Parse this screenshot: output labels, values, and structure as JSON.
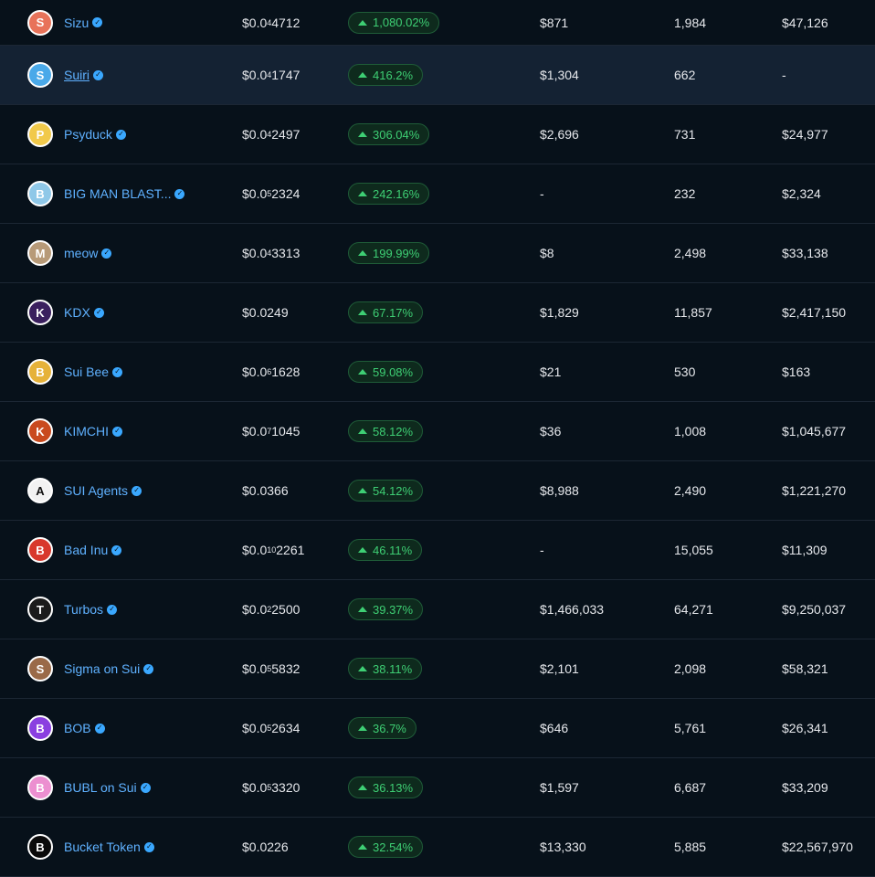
{
  "rows": [
    {
      "id": "sizu",
      "name": "Sizu",
      "avatar_color": "#e8735a",
      "avatar_glyph": "S",
      "price_prefix": "$0.0",
      "price_zeros": "4",
      "price_digits": "4712",
      "change": "1,080.02%",
      "liquidity": "$871",
      "holders": "1,984",
      "mcap": "$47,126"
    },
    {
      "id": "suiri",
      "name": "Suiri",
      "avatar_color": "#4aa9e9",
      "avatar_glyph": "S",
      "price_prefix": "$0.0",
      "price_zeros": "4",
      "price_digits": "1747",
      "change": "416.2%",
      "liquidity": "$1,304",
      "holders": "662",
      "mcap": "-"
    },
    {
      "id": "psyduck",
      "name": "Psyduck",
      "avatar_color": "#f1c94a",
      "avatar_glyph": "P",
      "price_prefix": "$0.0",
      "price_zeros": "4",
      "price_digits": "2497",
      "change": "306.04%",
      "liquidity": "$2,696",
      "holders": "731",
      "mcap": "$24,977"
    },
    {
      "id": "bigman",
      "name": "BIG MAN BLAST...",
      "avatar_color": "#8fc8e8",
      "avatar_glyph": "B",
      "price_prefix": "$0.0",
      "price_zeros": "5",
      "price_digits": "2324",
      "change": "242.16%",
      "liquidity": "-",
      "holders": "232",
      "mcap": "$2,324"
    },
    {
      "id": "meow",
      "name": "meow",
      "avatar_color": "#b79a78",
      "avatar_glyph": "M",
      "price_prefix": "$0.0",
      "price_zeros": "4",
      "price_digits": "3313",
      "change": "199.99%",
      "liquidity": "$8",
      "holders": "2,498",
      "mcap": "$33,138"
    },
    {
      "id": "kdx",
      "name": "KDX",
      "avatar_color": "#3a1f5e",
      "avatar_glyph": "K",
      "price_prefix": "$0.0249",
      "price_zeros": "",
      "price_digits": "",
      "change": "67.17%",
      "liquidity": "$1,829",
      "holders": "11,857",
      "mcap": "$2,417,150"
    },
    {
      "id": "suibee",
      "name": "Sui Bee",
      "avatar_color": "#e6b23a",
      "avatar_glyph": "B",
      "price_prefix": "$0.0",
      "price_zeros": "6",
      "price_digits": "1628",
      "change": "59.08%",
      "liquidity": "$21",
      "holders": "530",
      "mcap": "$163"
    },
    {
      "id": "kimchi",
      "name": "KIMCHI",
      "avatar_color": "#c94a1e",
      "avatar_glyph": "K",
      "price_prefix": "$0.0",
      "price_zeros": "7",
      "price_digits": "1045",
      "change": "58.12%",
      "liquidity": "$36",
      "holders": "1,008",
      "mcap": "$1,045,677"
    },
    {
      "id": "suiagents",
      "name": "SUI Agents",
      "avatar_color": "#f2f2f2",
      "avatar_glyph": "A",
      "price_prefix": "$0.0366",
      "price_zeros": "",
      "price_digits": "",
      "change": "54.12%",
      "liquidity": "$8,988",
      "holders": "2,490",
      "mcap": "$1,221,270"
    },
    {
      "id": "badinu",
      "name": "Bad Inu",
      "avatar_color": "#d8382c",
      "avatar_glyph": "B",
      "price_prefix": "$0.0",
      "price_zeros": "10",
      "price_digits": "2261",
      "change": "46.11%",
      "liquidity": "-",
      "holders": "15,055",
      "mcap": "$11,309"
    },
    {
      "id": "turbos",
      "name": "Turbos",
      "avatar_color": "#1b1b1b",
      "avatar_glyph": "T",
      "price_prefix": "$0.0",
      "price_zeros": "2",
      "price_digits": "2500",
      "change": "39.37%",
      "liquidity": "$1,466,033",
      "holders": "64,271",
      "mcap": "$9,250,037"
    },
    {
      "id": "sigma",
      "name": "Sigma on Sui",
      "avatar_color": "#9a6a48",
      "avatar_glyph": "S",
      "price_prefix": "$0.0",
      "price_zeros": "5",
      "price_digits": "5832",
      "change": "38.11%",
      "liquidity": "$2,101",
      "holders": "2,098",
      "mcap": "$58,321"
    },
    {
      "id": "bob",
      "name": "BOB",
      "avatar_color": "#8a3fe0",
      "avatar_glyph": "B",
      "price_prefix": "$0.0",
      "price_zeros": "5",
      "price_digits": "2634",
      "change": "36.7%",
      "liquidity": "$646",
      "holders": "5,761",
      "mcap": "$26,341"
    },
    {
      "id": "bubl",
      "name": "BUBL on Sui",
      "avatar_color": "#ec8fd0",
      "avatar_glyph": "B",
      "price_prefix": "$0.0",
      "price_zeros": "5",
      "price_digits": "3320",
      "change": "36.13%",
      "liquidity": "$1,597",
      "holders": "6,687",
      "mcap": "$33,209"
    },
    {
      "id": "bucket",
      "name": "Bucket Token",
      "avatar_color": "#0a0a0a",
      "avatar_glyph": "B",
      "price_prefix": "$0.0226",
      "price_zeros": "",
      "price_digits": "",
      "change": "32.54%",
      "liquidity": "$13,330",
      "holders": "5,885",
      "mcap": "$22,567,970"
    }
  ]
}
